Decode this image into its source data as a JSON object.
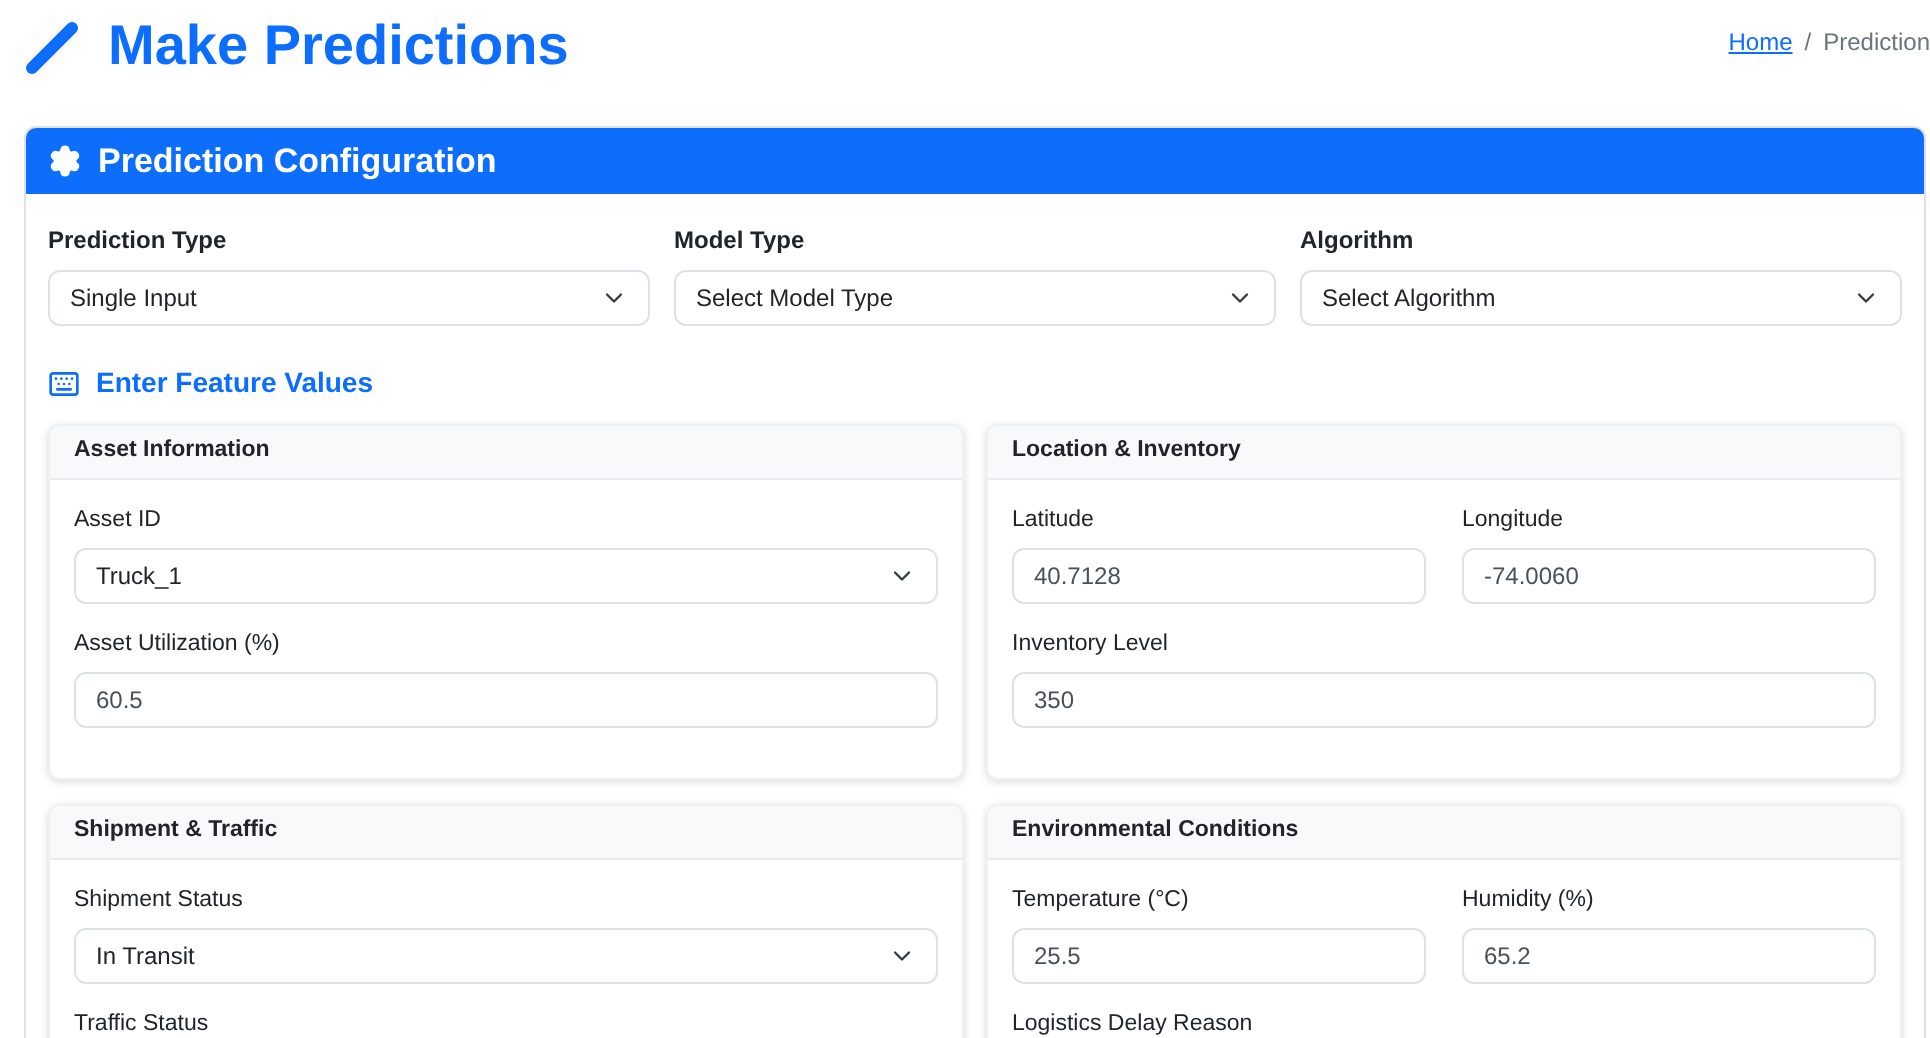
{
  "page_title": "Make Predictions",
  "breadcrumb": {
    "home": "Home",
    "separator": "/",
    "current": "Prediction"
  },
  "config": {
    "title": "Prediction Configuration",
    "selects": [
      {
        "label": "Prediction Type",
        "value": "Single Input"
      },
      {
        "label": "Model Type",
        "value": "Select Model Type"
      },
      {
        "label": "Algorithm",
        "value": "Select Algorithm"
      }
    ],
    "features_title": "Enter Feature Values",
    "cards": [
      {
        "title": "Asset Information",
        "rows": [
          [
            {
              "label": "Asset ID",
              "kind": "select",
              "value": "Truck_1"
            }
          ],
          [
            {
              "label": "Asset Utilization (%)",
              "kind": "input",
              "value": "60.5"
            }
          ]
        ]
      },
      {
        "title": "Location & Inventory",
        "rows": [
          [
            {
              "label": "Latitude",
              "kind": "input",
              "value": "40.7128"
            },
            {
              "label": "Longitude",
              "kind": "input",
              "value": "-74.0060"
            }
          ],
          [
            {
              "label": "Inventory Level",
              "kind": "input",
              "value": "350"
            }
          ]
        ]
      },
      {
        "title": "Shipment & Traffic",
        "rows": [
          [
            {
              "label": "Shipment Status",
              "kind": "select",
              "value": "In Transit"
            }
          ],
          [
            {
              "label": "Traffic Status"
            }
          ]
        ]
      },
      {
        "title": "Environmental Conditions",
        "rows": [
          [
            {
              "label": "Temperature (°C)",
              "kind": "input",
              "value": "25.5"
            },
            {
              "label": "Humidity (%)",
              "kind": "input",
              "value": "65.2"
            }
          ],
          [
            {
              "label": "Logistics Delay Reason"
            }
          ]
        ]
      }
    ]
  }
}
